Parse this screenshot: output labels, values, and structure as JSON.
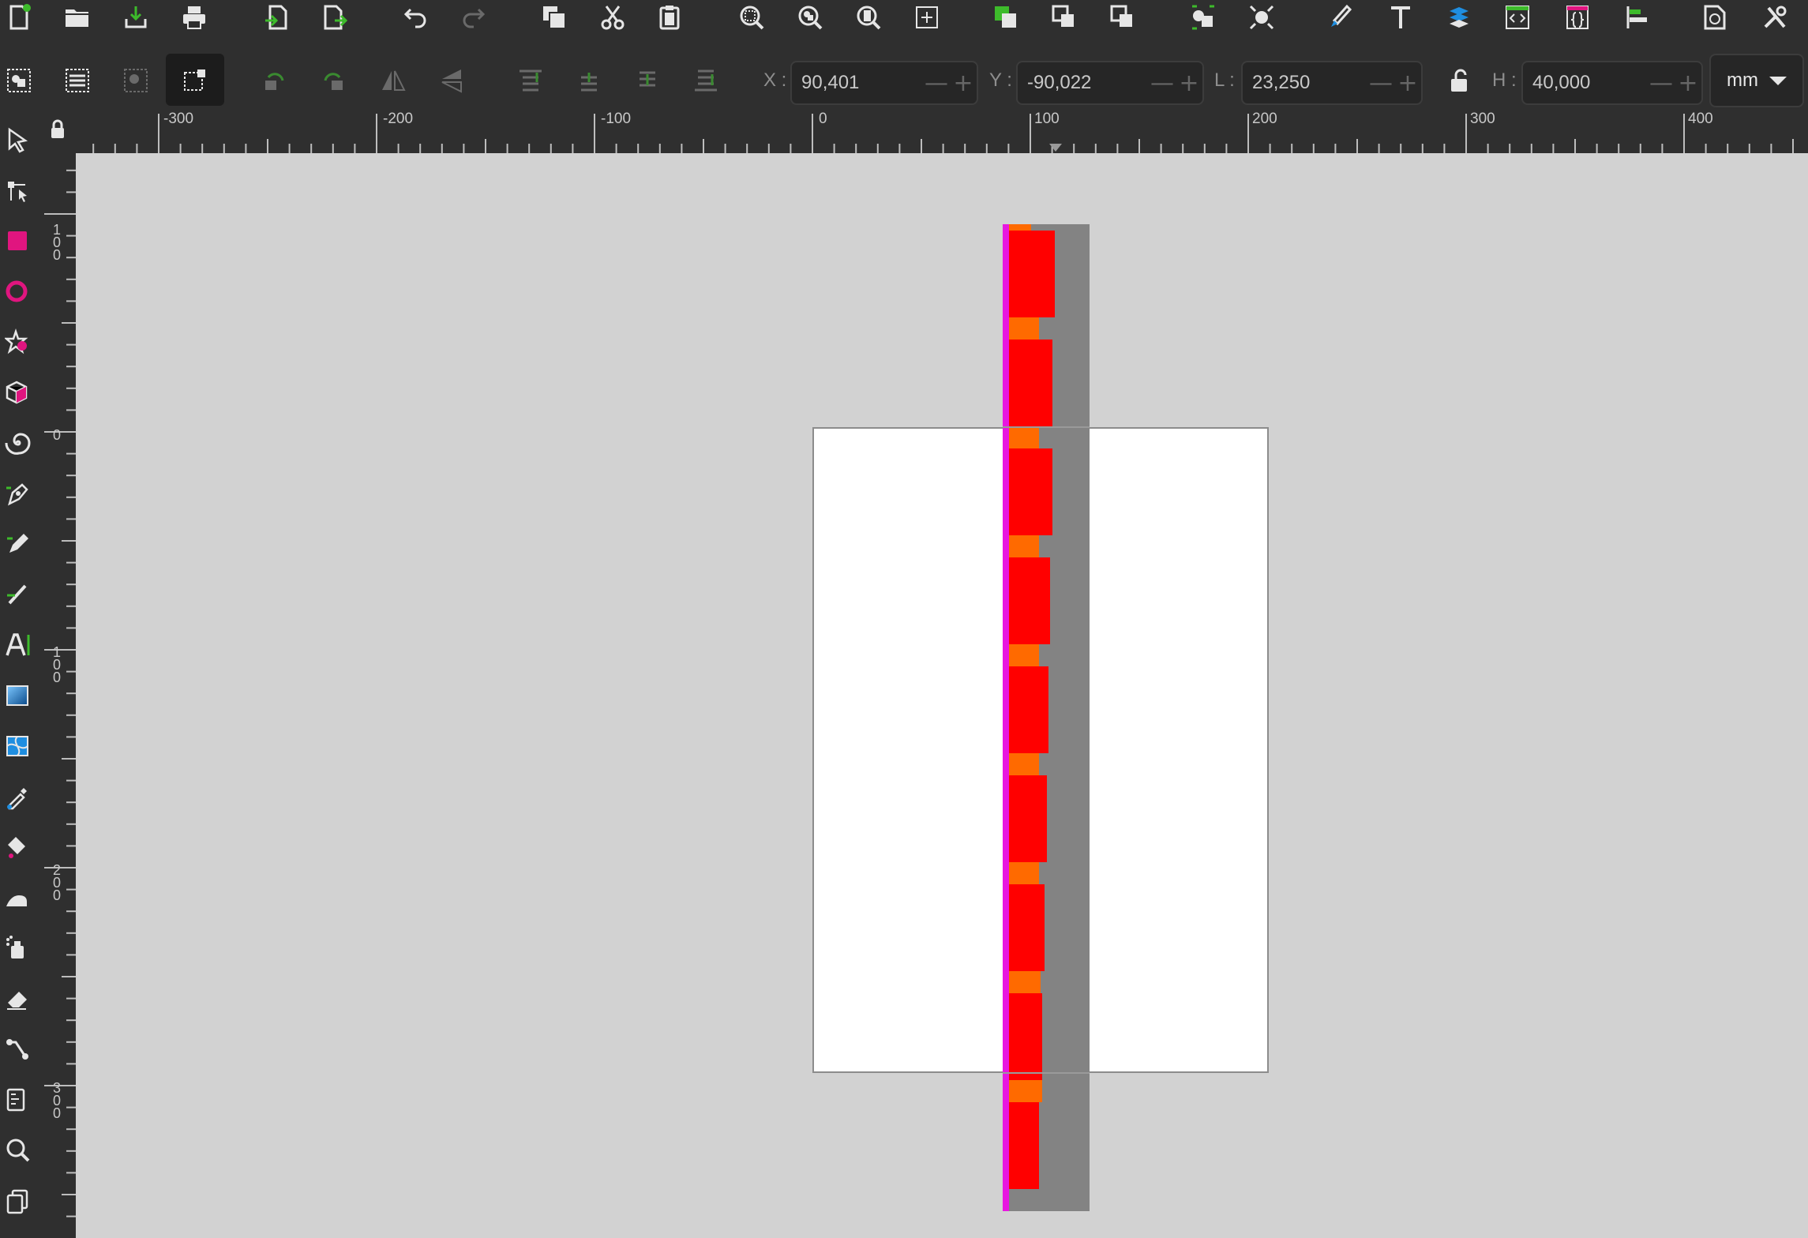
{
  "toolbar": {
    "commands": [
      {
        "name": "new-document"
      },
      {
        "name": "open"
      },
      {
        "name": "save"
      },
      {
        "name": "print"
      },
      {
        "name": "import"
      },
      {
        "name": "export"
      },
      {
        "name": "undo"
      },
      {
        "name": "redo"
      },
      {
        "name": "duplicate"
      },
      {
        "name": "cut"
      },
      {
        "name": "paste"
      },
      {
        "name": "zoom-selection"
      },
      {
        "name": "zoom-drawing"
      },
      {
        "name": "zoom-page"
      },
      {
        "name": "zoom-1-1"
      },
      {
        "name": "group"
      },
      {
        "name": "ungroup"
      },
      {
        "name": "lock"
      },
      {
        "name": "object-properties"
      },
      {
        "name": "fill-stroke"
      },
      {
        "name": "text-font"
      },
      {
        "name": "layers"
      },
      {
        "name": "xml-editor"
      },
      {
        "name": "selectors-css"
      },
      {
        "name": "align-distribute"
      },
      {
        "name": "document-properties"
      },
      {
        "name": "preferences"
      }
    ]
  },
  "controls": {
    "x": {
      "label": "X :",
      "value": "90,401"
    },
    "y": {
      "label": "Y :",
      "value": "-90,022"
    },
    "w": {
      "label": "L :",
      "value": "23,250"
    },
    "h": {
      "label": "H :",
      "value": "40,000"
    },
    "unit": "mm"
  },
  "ruler": {
    "h_labels": [
      "-300",
      "-200",
      "-100",
      "0",
      "100",
      "200",
      "300",
      "400"
    ],
    "v_labels": [
      "1\n0\n0",
      "0",
      "1\n0\n0",
      "2\n0\n0",
      "3\n0\n0"
    ]
  },
  "colors": {
    "chrome": "#2f2f2f",
    "canvas": "#d2d2d2",
    "page": "#ffffff",
    "red": "#ff0000",
    "orange": "#ff6a00",
    "gray": "#838383",
    "magenta": "#e817e0"
  }
}
